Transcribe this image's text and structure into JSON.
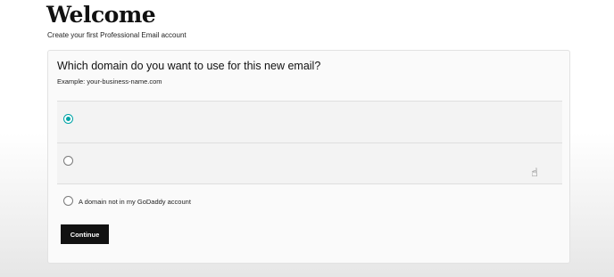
{
  "header": {
    "title": "Welcome",
    "subtitle": "Create your first Professional Email account"
  },
  "form": {
    "question": "Which domain do you want to use for this new email?",
    "example": "Example: your-business-name.com",
    "options": [
      {
        "label": "",
        "selected": true
      },
      {
        "label": "",
        "selected": false
      },
      {
        "label": "A domain not in my GoDaddy account",
        "selected": false
      }
    ],
    "continue_label": "Continue"
  },
  "colors": {
    "accent": "#00a4a6",
    "button": "#111111"
  }
}
